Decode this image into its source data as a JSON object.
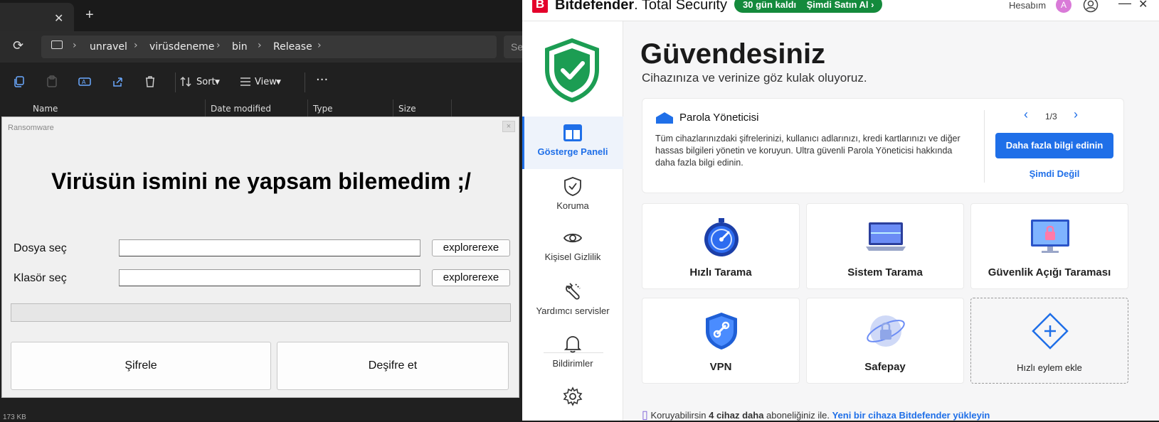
{
  "explorer": {
    "breadcrumb": [
      "unravel",
      "virüsdeneme",
      "bin",
      "Release"
    ],
    "search_placeholder": "Se",
    "toolbar": {
      "sort_label": "Sort",
      "view_label": "View"
    },
    "columns": [
      "Name",
      "Date modified",
      "Type",
      "Size"
    ],
    "status": "173 KB"
  },
  "dialog": {
    "title": "Ransomware",
    "close_glyph": "×",
    "heading": "Virüsün ismini ne yapsam bilemedim ;/",
    "file_label": "Dosya seç",
    "folder_label": "Klasör seç",
    "file_value": "",
    "folder_value": "",
    "browse_file_label": "explorerexe",
    "browse_folder_label": "explorerexe",
    "progress": 0,
    "encrypt_label": "Şifrele",
    "decrypt_label": "Deşifre et"
  },
  "bitdefender": {
    "brand": "Bitdefender",
    "product": "Total Security",
    "trial_days": "30 gün kaldı",
    "buy_now": "Şimdi Satın Al",
    "account_label": "Hesabım",
    "avatar_letter": "A",
    "accent_color": "#1f6fe8",
    "nav": [
      {
        "label": "Gösterge Paneli",
        "icon": "dashboard-icon"
      },
      {
        "label": "Koruma",
        "icon": "shield-check-icon"
      },
      {
        "label": "Kişisel Gizlilik",
        "icon": "eye-icon"
      },
      {
        "label": "Yardımcı servisler",
        "icon": "tools-icon"
      },
      {
        "label": "Bildirimler",
        "icon": "bell-icon"
      },
      {
        "label": "",
        "icon": "gear-icon"
      }
    ],
    "status_title": "Güvendesiniz",
    "status_subtitle": "Cihazınıza ve verinize göz kulak oluyoruz.",
    "card": {
      "title": "Parola Yöneticisi",
      "text": "Tüm cihazlarınızdaki şifrelerinizi, kullanıcı adlarınızı, kredi kartlarınızı ve diğer hassas bilgileri yönetin ve koruyun. Ultra güvenli Parola Yöneticisi hakkında daha fazla bilgi edinin.",
      "page": "1/3",
      "cta": "Daha fazla bilgi edinin",
      "later": "Şimdi Değil"
    },
    "tiles": [
      {
        "label": "Hızlı Tarama",
        "icon": "stopwatch-icon"
      },
      {
        "label": "Sistem Tarama",
        "icon": "laptop-icon"
      },
      {
        "label": "Güvenlik Açığı Taraması",
        "icon": "monitor-lock-icon"
      },
      {
        "label": "VPN",
        "icon": "vpn-shield-icon"
      },
      {
        "label": "Safepay",
        "icon": "safepay-lock-icon"
      },
      {
        "label": "Hızlı eylem ekle",
        "icon": "plus-diamond-icon"
      }
    ],
    "footer": {
      "prefix": "Koruyabilirsin",
      "count": "4 cihaz daha",
      "middle": "aboneliğiniz ile.",
      "link": "Yeni bir cihaza Bitdefender yükleyin"
    }
  }
}
